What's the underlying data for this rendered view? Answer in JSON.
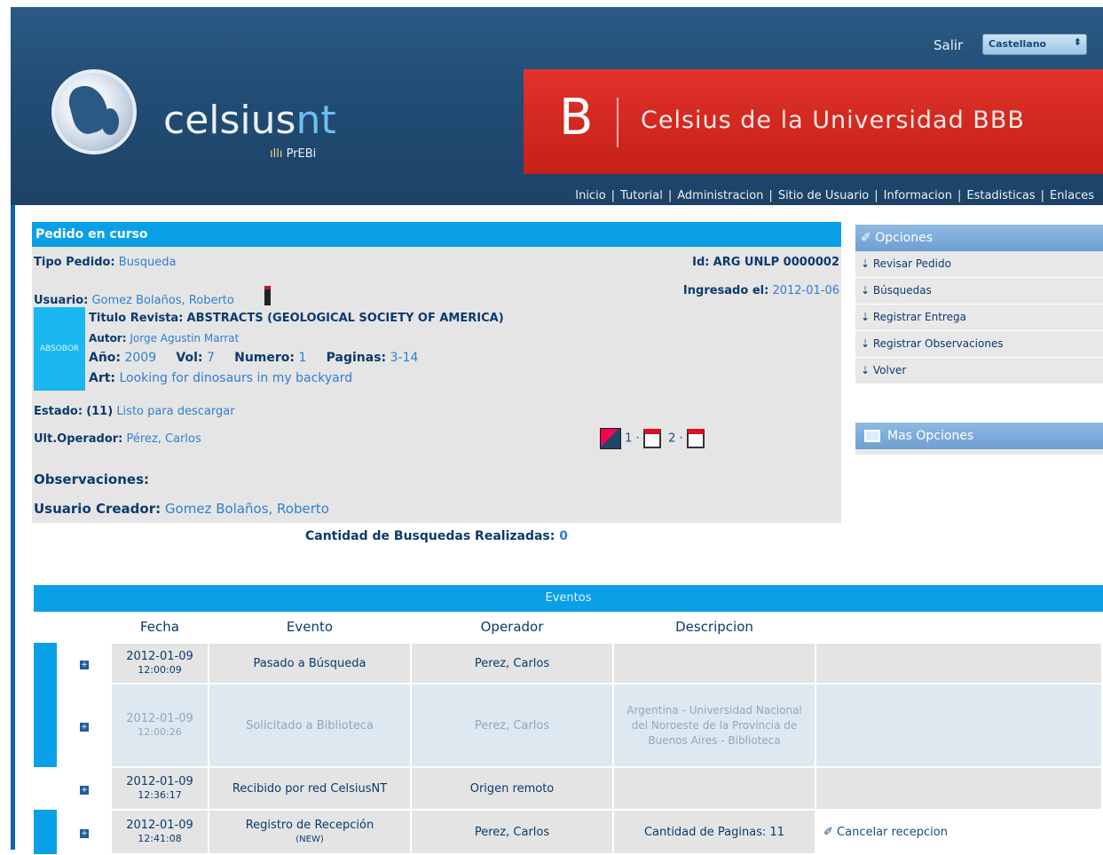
{
  "header": {
    "brand": "celsius",
    "brand_accent": "nt",
    "subbrand": "PrEBi",
    "salir": "Salir",
    "language": "Castellano",
    "banner_letter": "B",
    "banner_title": "Celsius de la Universidad BBB",
    "nav": [
      "Inicio",
      "Tutorial",
      "Administracion",
      "Sitio de Usuario",
      "Informacion",
      "Estadisticas",
      "Enlaces"
    ]
  },
  "pedido": {
    "title": "Pedido en curso",
    "tipo_label": "Tipo Pedido:",
    "tipo_value": "Busqueda",
    "id_label": "Id:",
    "id_value": "ARG UNLP 0000002",
    "usuario_label": "Usuario:",
    "usuario_value": "Gomez Bolaños, Roberto",
    "ingresado_label": "Ingresado el:",
    "ingresado_value": "2012-01-06",
    "thumb_text": "ABSOBOR",
    "revista_label": "Titulo Revista:",
    "revista_value": "ABSTRACTS (GEOLOGICAL SOCIETY OF AMERICA)",
    "autor_label": "Autor:",
    "autor_value": "Jorge Agustin Marrat",
    "anio_label": "Año:",
    "anio_value": "2009",
    "vol_label": "Vol:",
    "vol_value": "7",
    "numero_label": "Numero:",
    "numero_value": "1",
    "paginas_label": "Paginas:",
    "paginas_value": "3-14",
    "art_label": "Art:",
    "art_value": "Looking for dinosaurs in my backyard",
    "estado_label": "Estado:",
    "estado_code": "(11)",
    "estado_value": "Listo para descargar",
    "operador_label": "Ult.Operador:",
    "operador_value": "Pérez, Carlos",
    "file_1": "1",
    "file_2": "2",
    "observaciones_label": "Observaciones:",
    "creador_label": "Usuario Creador:",
    "creador_value": "Gomez Bolaños, Roberto",
    "busquedas_label": "Cantidad de Busquedas Realizadas:",
    "busquedas_value": "0"
  },
  "opciones": {
    "title": "Opciones",
    "items": [
      "Revisar Pedido",
      "Búsquedas",
      "Registrar Entrega",
      "Registrar Observaciones",
      "Volver"
    ],
    "mas": "Mas Opciones"
  },
  "eventos": {
    "title": "Eventos",
    "columns": [
      "Fecha",
      "Evento",
      "Operador",
      "Descripcion"
    ],
    "rows": [
      {
        "date": "2012-01-09",
        "time": "12:00:09",
        "evento": "Pasado a Búsqueda",
        "operador": "Perez, Carlos",
        "descripcion": "",
        "accion": ""
      },
      {
        "date": "2012-01-09",
        "time": "12:00:26",
        "evento": "Solicitado a Biblioteca",
        "operador": "Perez, Carlos",
        "descripcion": "Argentina - Universidad Nacional del Noroeste de la Provincia de Buenos Aires - Biblioteca",
        "accion": ""
      },
      {
        "date": "2012-01-09",
        "time": "12:36:17",
        "evento": "Recibido por red CelsiusNT",
        "operador": "Origen remoto",
        "descripcion": "",
        "accion": ""
      },
      {
        "date": "2012-01-09",
        "time": "12:41:08",
        "evento": "Registro de Recepción",
        "evento_sub": "(NEW)",
        "operador": "Perez, Carlos",
        "descripcion": "Cantidad de Paginas: 11",
        "accion": "Cancelar recepcion"
      }
    ]
  }
}
